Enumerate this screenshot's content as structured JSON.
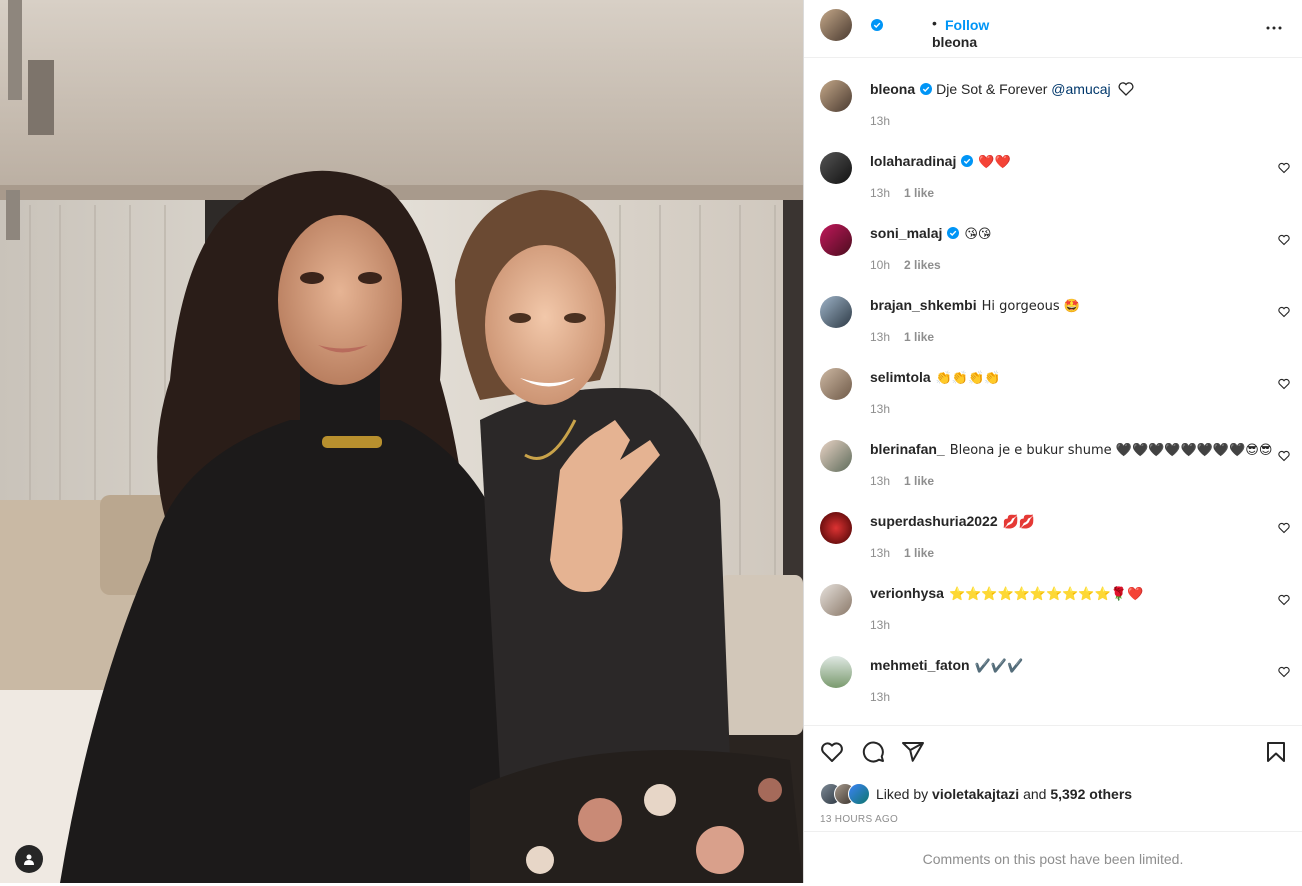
{
  "post": {
    "author": "bleona",
    "follow_label": "Follow",
    "separator": "•",
    "caption": {
      "username": "bleona",
      "text": "Dje Sot & Forever ",
      "mention": "@amucaj",
      "time": "13h"
    }
  },
  "comments": [
    {
      "username": "lolaharadinaj",
      "verified": true,
      "text": "❤️❤️",
      "time": "13h",
      "likes": "1 like"
    },
    {
      "username": "soni_malaj",
      "verified": true,
      "text": "😘😘",
      "time": "10h",
      "likes": "2 likes"
    },
    {
      "username": "brajan_shkembi",
      "verified": false,
      "text": "Hi gorgeous 🤩",
      "time": "13h",
      "likes": "1 like"
    },
    {
      "username": "selimtola",
      "verified": false,
      "text": "👏👏👏👏",
      "time": "13h",
      "likes": ""
    },
    {
      "username": "blerinafan_",
      "verified": false,
      "text": "Bleona je e bukur shume 🖤🖤🖤🖤🖤🖤🖤🖤😎😎",
      "time": "13h",
      "likes": "1 like"
    },
    {
      "username": "superdashuria2022",
      "verified": false,
      "text": "💋💋",
      "time": "13h",
      "likes": "1 like"
    },
    {
      "username": "verionhysa",
      "verified": false,
      "text": "⭐⭐⭐⭐⭐⭐⭐⭐⭐⭐🌹❤️",
      "time": "13h",
      "likes": ""
    },
    {
      "username": "mehmeti_faton",
      "verified": false,
      "text": "✔️✔️✔️",
      "time": "13h",
      "likes": ""
    }
  ],
  "likes": {
    "prefix": "Liked by ",
    "user": "violetakajtazi",
    "middle": " and ",
    "others": "5,392 others"
  },
  "timestamp": "13 HOURS AGO",
  "comments_limited": "Comments on this post have been limited.",
  "icons": {
    "verified": "verified-badge-icon",
    "more": "more-options-icon",
    "like": "heart-icon",
    "comment": "comment-icon",
    "share": "share-icon",
    "save": "bookmark-icon",
    "tagged": "user-tag-icon"
  },
  "colors": {
    "accent": "#0095f6",
    "verified": "#0095f6",
    "text": "#262626",
    "secondary": "#8e8e8e",
    "heart_red": "#ed4956"
  }
}
